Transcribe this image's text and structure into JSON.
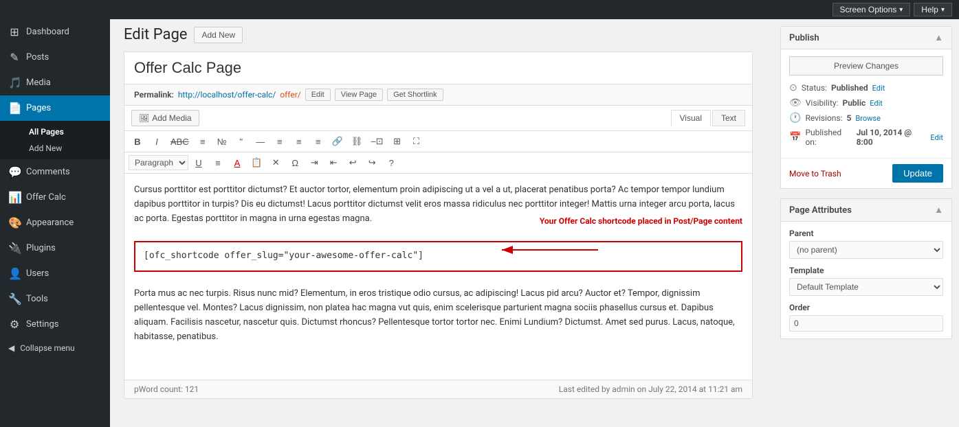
{
  "topbar": {
    "screen_options_label": "Screen Options",
    "help_label": "Help"
  },
  "sidebar": {
    "items": [
      {
        "id": "dashboard",
        "icon": "⊞",
        "label": "Dashboard"
      },
      {
        "id": "posts",
        "icon": "📝",
        "label": "Posts"
      },
      {
        "id": "media",
        "icon": "🎵",
        "label": "Media"
      },
      {
        "id": "pages",
        "icon": "📄",
        "label": "Pages",
        "active": true
      },
      {
        "id": "comments",
        "icon": "💬",
        "label": "Comments"
      },
      {
        "id": "offer-calc",
        "icon": "📊",
        "label": "Offer Calc"
      },
      {
        "id": "appearance",
        "icon": "🎨",
        "label": "Appearance"
      },
      {
        "id": "plugins",
        "icon": "🔌",
        "label": "Plugins"
      },
      {
        "id": "users",
        "icon": "👤",
        "label": "Users"
      },
      {
        "id": "tools",
        "icon": "🔧",
        "label": "Tools"
      },
      {
        "id": "settings",
        "icon": "⚙",
        "label": "Settings"
      }
    ],
    "pages_sub": [
      {
        "label": "All Pages",
        "active": true
      },
      {
        "label": "Add New"
      }
    ],
    "collapse_label": "Collapse menu"
  },
  "page_header": {
    "title": "Edit Page",
    "add_new_label": "Add New"
  },
  "post": {
    "title": "Offer Calc Page",
    "permalink_label": "Permalink:",
    "permalink_url": "http://localhost/offer-calc/",
    "permalink_slug": "offer/",
    "edit_label": "Edit",
    "view_page_label": "View Page",
    "get_shortlink_label": "Get Shortlink"
  },
  "editor": {
    "add_media_label": "Add Media",
    "view_visual_label": "Visual",
    "view_text_label": "Text",
    "toolbar": {
      "bold": "B",
      "italic": "I",
      "strikethrough": "S̶",
      "bullet_list": "≡",
      "number_list": "≡",
      "blockquote": "❝",
      "hr": "—",
      "align_left": "⫷",
      "align_center": "≡",
      "align_right": "⫸",
      "link": "🔗",
      "unlink": "⛓",
      "more": "⋯",
      "fullscreen": "⛶",
      "paragraph_select": "Paragraph",
      "underline": "U",
      "align_justify": "⫶",
      "text_color": "A",
      "paste_text": "📋",
      "erase": "✕",
      "omega": "Ω",
      "indent": "⇥",
      "outdent": "⇤",
      "undo": "↩",
      "redo": "↪",
      "help": "?"
    },
    "paragraph1": "Cursus porttitor est porttitor dictumst? Et auctor tortor, elementum proin adipiscing ut a vel a ut, placerat penatibus porta? Ac tempor tempor lundium dapibus porttitor in turpis? Dis eu dictumst! Lacus porttitor dictumst velit eros massa ridiculus nec porttitor integer! Mattis urna integer arcu porta, lacus ac porta. Egestas porttitor in magna in urna egestas magna.",
    "shortcode": "[ofc_shortcode offer_slug=\"your-awesome-offer-calc\"]",
    "shortcode_annotation": "Your Offer Calc shortcode placed in Post/Page content",
    "paragraph2": "Porta mus ac nec turpis. Risus nunc mid? Elementum, in eros tristique odio cursus, ac adipiscing! Lacus pid arcu? Auctor et? Tempor, dignissim pellentesque vel. Montes? Lacus dignissim, non platea hac magna vut quis, enim scelerisque parturient magna sociis phasellus cursus et. Dapibus aliquam. Facilisis nascetur, nascetur quis. Dictumst rhoncus? Pellentesque tortor tortor nec. Enimi Lundium? Dictumst. Amet sed purus. Lacus, natoque, habitasse, penatibus.",
    "path_indicator": "p",
    "word_count_label": "Word count: 121",
    "last_edited": "Last edited by admin on July 22, 2014 at 11:21 am"
  },
  "publish_box": {
    "title": "Publish",
    "preview_changes_label": "Preview Changes",
    "status_label": "Status:",
    "status_value": "Published",
    "status_edit": "Edit",
    "visibility_label": "Visibility:",
    "visibility_value": "Public",
    "visibility_edit": "Edit",
    "revisions_label": "Revisions:",
    "revisions_count": "5",
    "revisions_browse": "Browse",
    "published_label": "Published on:",
    "published_date": "Jul 10, 2014 @ 8:00",
    "published_edit": "Edit",
    "move_trash_label": "Move to Trash",
    "update_label": "Update"
  },
  "page_attributes": {
    "title": "Page Attributes",
    "parent_label": "Parent",
    "parent_options": [
      "(no parent)"
    ],
    "template_label": "Template",
    "template_options": [
      "Default Template"
    ],
    "order_label": "Order",
    "order_value": "0"
  }
}
